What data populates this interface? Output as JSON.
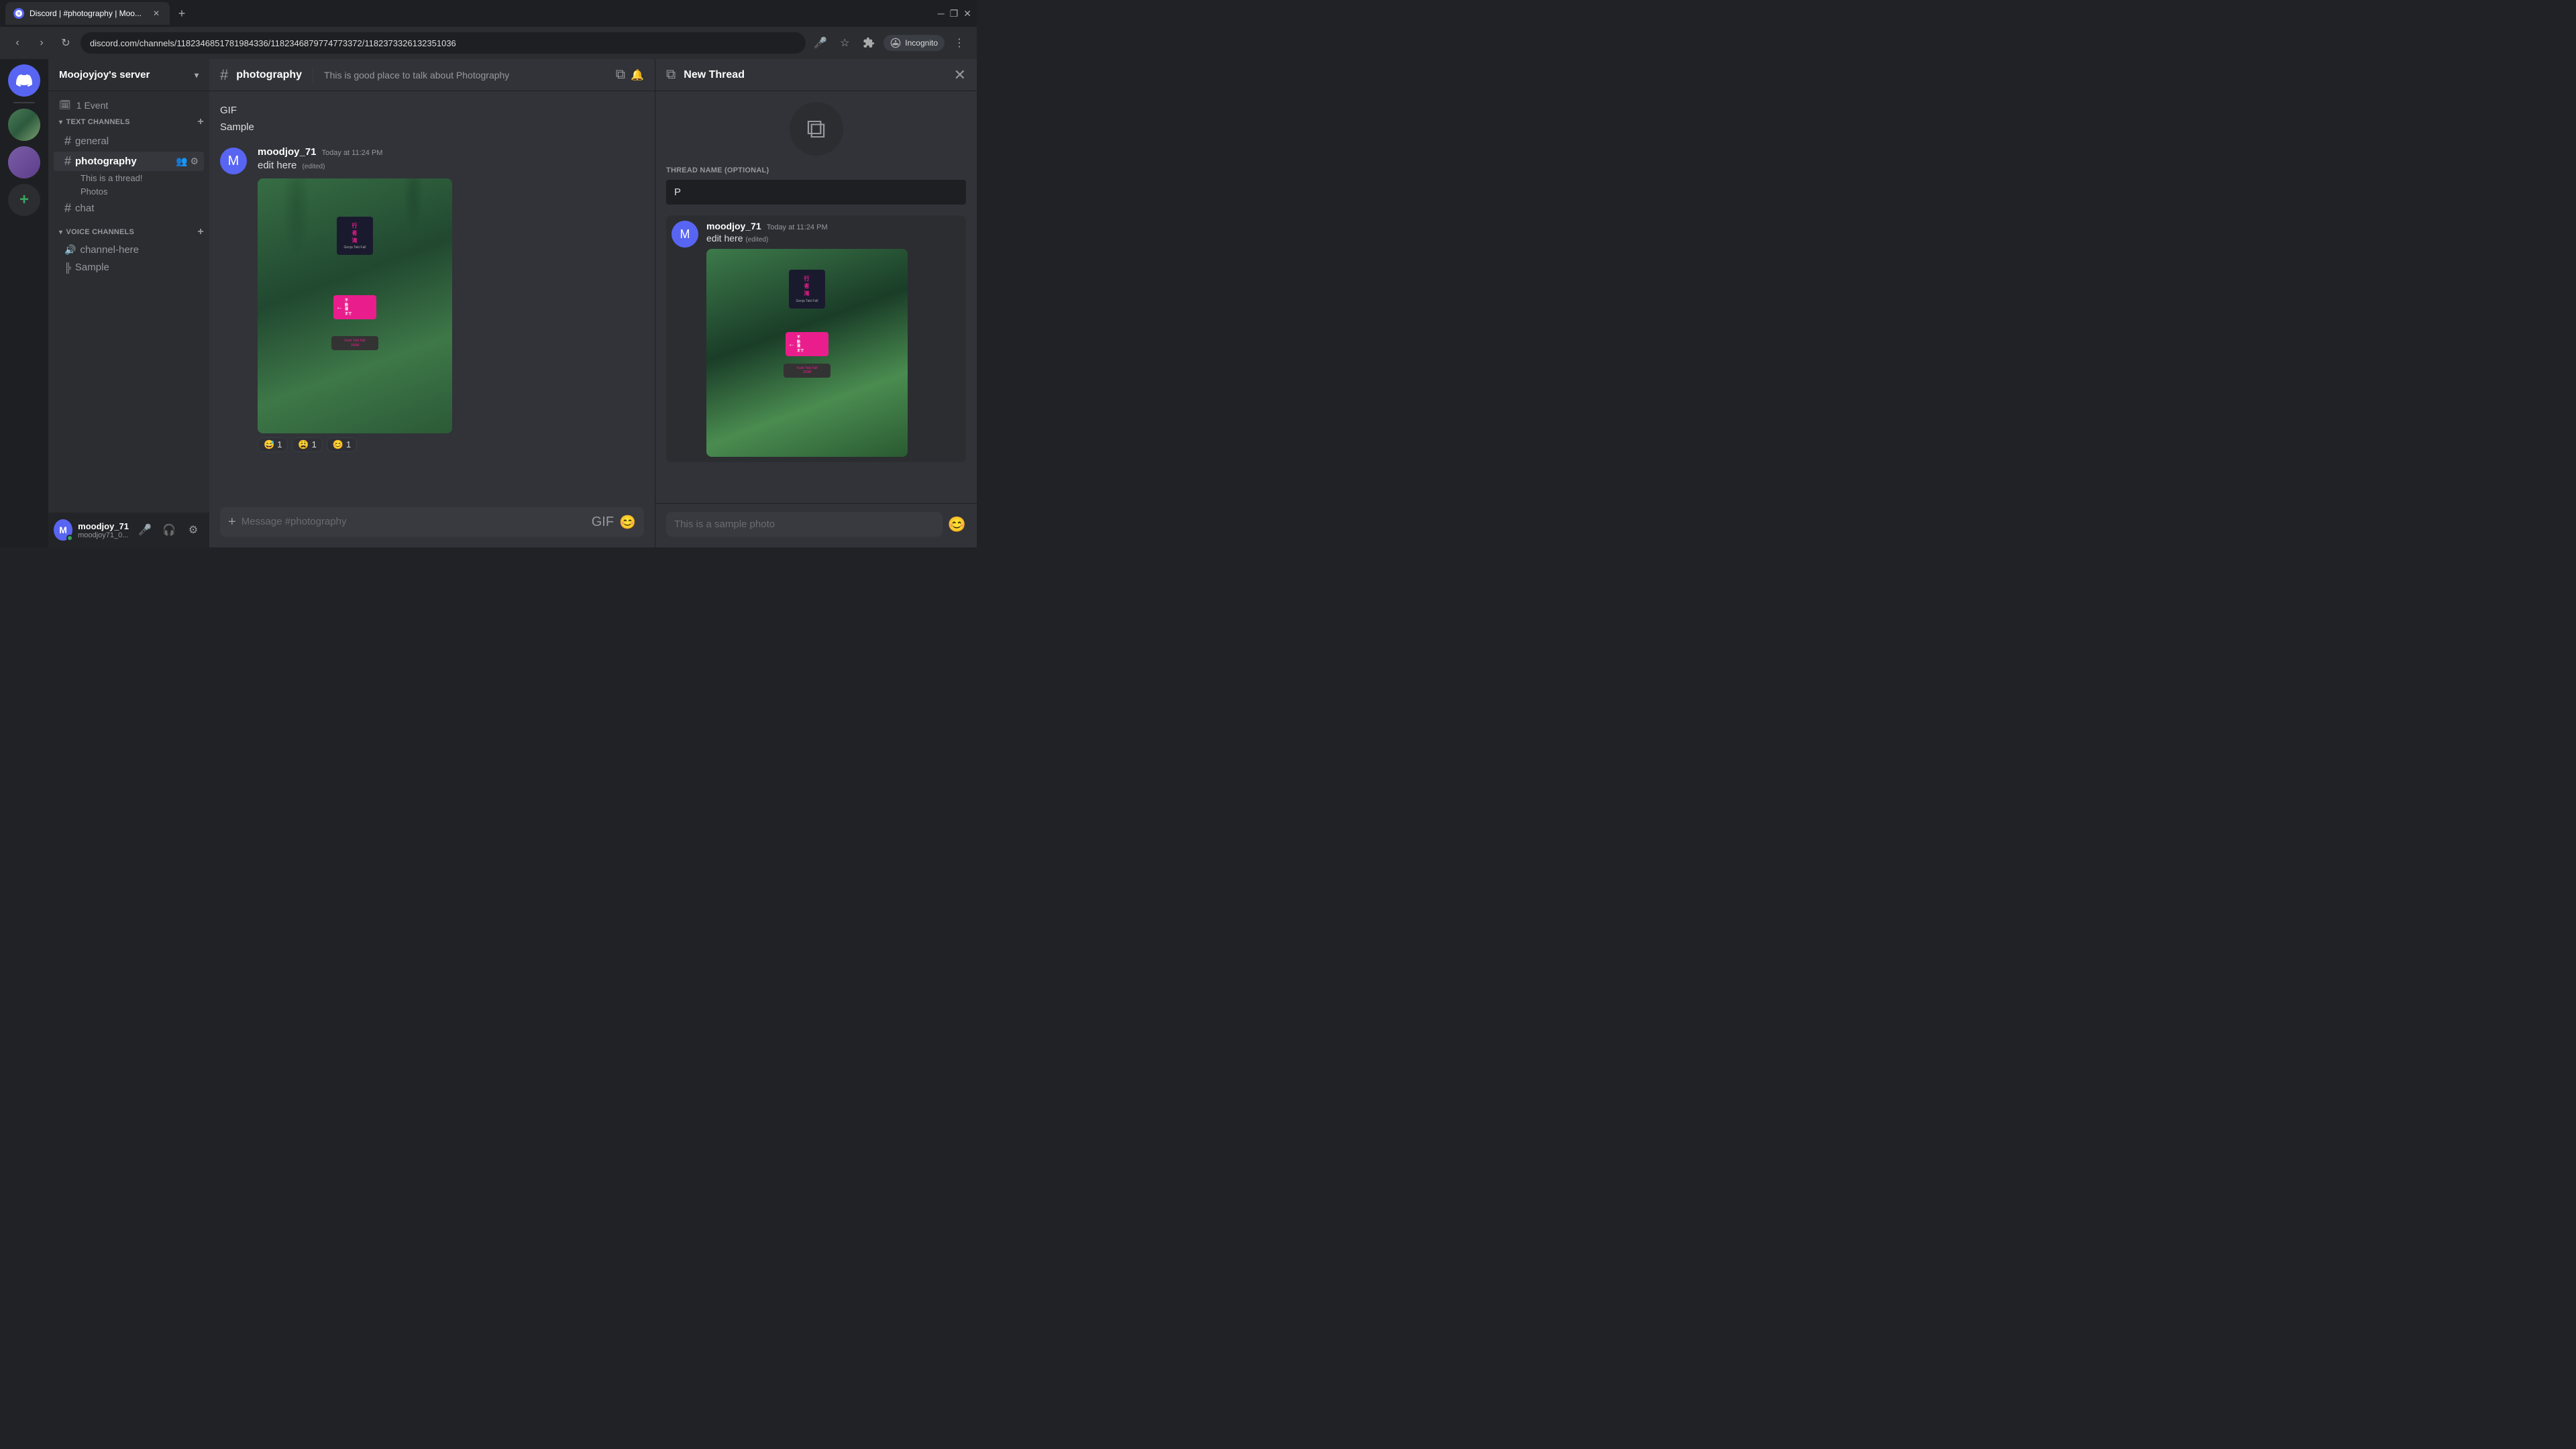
{
  "browser": {
    "tab_label": "Discord | #photography | Moo...",
    "url": "discord.com/channels/1182346851781984336/1182346879774773372/1182373326132351036",
    "incognito_label": "Incognito"
  },
  "server": {
    "name": "Moojoyjoy's server",
    "event_count": "1 Event"
  },
  "sidebar": {
    "text_channels_label": "TEXT CHANNELS",
    "voice_channels_label": "VOICE CHANNELS",
    "channels": [
      {
        "name": "general",
        "type": "text",
        "active": false
      },
      {
        "name": "photography",
        "type": "text",
        "active": true
      },
      {
        "name": "chat",
        "type": "text",
        "active": false
      },
      {
        "name": "channel-here",
        "type": "voice"
      },
      {
        "name": "Sample",
        "type": "voice-thread"
      }
    ],
    "threads": [
      {
        "name": "This is a thread!"
      },
      {
        "name": "Photos"
      }
    ]
  },
  "channel": {
    "name": "photography",
    "description": "This is good place to talk about Photography",
    "message_placeholder": "Message #photography"
  },
  "messages": [
    {
      "author": "moodjoy_71",
      "time": "Today at 11:24 PM",
      "text": "edit here",
      "edited": true,
      "has_image": true,
      "reactions": [
        {
          "emoji": "😅",
          "count": "1"
        },
        {
          "emoji": "😩",
          "count": "1"
        },
        {
          "emoji": "😊",
          "count": "1"
        }
      ]
    }
  ],
  "misc_items": [
    {
      "label": "GIF"
    },
    {
      "label": "Sample"
    }
  ],
  "thread_panel": {
    "title": "New Thread",
    "name_label": "THREAD NAME (OPTIONAL)",
    "name_value": "P",
    "name_placeholder": "",
    "message_author": "moodjoy_71",
    "message_time": "Today at 11:24 PM",
    "message_text": "edit here",
    "message_edited": true,
    "message_caption": "This is a sample photo"
  },
  "user": {
    "name": "moodjoy_71",
    "tag": "moodjoy71_0..."
  },
  "icons": {
    "hash": "#",
    "add": "+",
    "chevron_down": "▾",
    "close": "✕",
    "settings": "⚙",
    "members": "👥",
    "thread": "⧉"
  }
}
